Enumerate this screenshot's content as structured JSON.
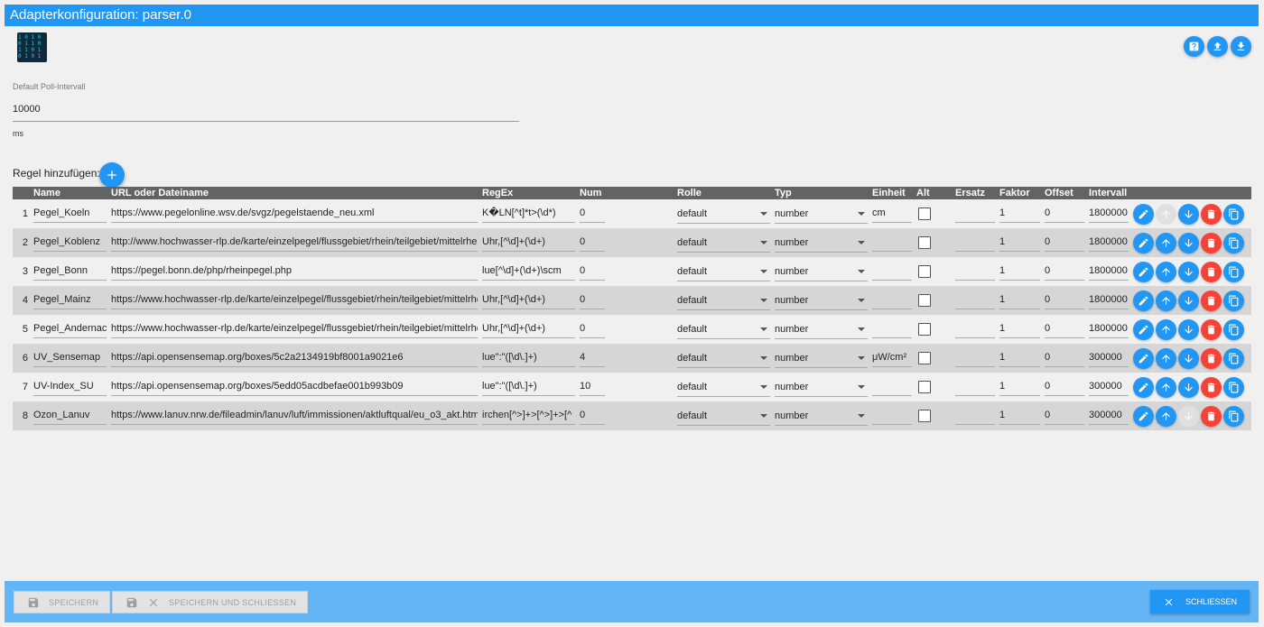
{
  "window": {
    "title": "Adapterkonfiguration: parser.0"
  },
  "logo": {
    "glyph_rows": [
      "1 0 1 0",
      "0 1 1 0",
      "1 1 0 1",
      "0 1 0 1"
    ]
  },
  "poll": {
    "label": "Default Poll-Intervall",
    "value": "10000",
    "unit": "ms"
  },
  "add_rule": {
    "label": "Regel hinzufügen:"
  },
  "table": {
    "headers": [
      "",
      "Name",
      "URL oder Dateiname",
      "RegEx",
      "Num",
      "Rolle",
      "Typ",
      "Einheit",
      "Alt",
      "Ersatz",
      "Faktor",
      "Offset",
      "Intervall",
      ""
    ],
    "rows": [
      {
        "index": "1",
        "name": "Pegel_Koeln",
        "url": "https://www.pegelonline.wsv.de/svgz/pegelstaende_neu.xml",
        "regex": "K�LN[^t]*t>(\\d*)",
        "num": "0",
        "role": "default",
        "type": "number",
        "unit": "cm",
        "subst": "",
        "factor": "1",
        "offset": "0",
        "interval": "1800000",
        "up_enabled": false,
        "down_enabled": true
      },
      {
        "index": "2",
        "name": "Pegel_Koblenz",
        "url": "http://www.hochwasser-rlp.de/karte/einzelpegel/flussgebiet/rhein/teilgebiet/mittelrhein",
        "regex": "Uhr,[^\\d]+(\\d+)",
        "num": "0",
        "role": "default",
        "type": "number",
        "unit": "",
        "subst": "",
        "factor": "1",
        "offset": "0",
        "interval": "1800000",
        "up_enabled": true,
        "down_enabled": true
      },
      {
        "index": "3",
        "name": "Pegel_Bonn",
        "url": "https://pegel.bonn.de/php/rheinpegel.php",
        "regex": "lue[^\\d]+(\\d+)\\scm",
        "num": "0",
        "role": "default",
        "type": "number",
        "unit": "",
        "subst": "",
        "factor": "1",
        "offset": "0",
        "interval": "1800000",
        "up_enabled": true,
        "down_enabled": true
      },
      {
        "index": "4",
        "name": "Pegel_Mainz",
        "url": "https://www.hochwasser-rlp.de/karte/einzelpegel/flussgebiet/rhein/teilgebiet/mittelrhein",
        "regex": "Uhr,[^\\d]+(\\d+)",
        "num": "0",
        "role": "default",
        "type": "number",
        "unit": "",
        "subst": "",
        "factor": "1",
        "offset": "0",
        "interval": "1800000",
        "up_enabled": true,
        "down_enabled": true
      },
      {
        "index": "5",
        "name": "Pegel_Andernach",
        "url": "https://www.hochwasser-rlp.de/karte/einzelpegel/flussgebiet/rhein/teilgebiet/mittelrhein",
        "regex": "Uhr,[^\\d]+(\\d+)",
        "num": "0",
        "role": "default",
        "type": "number",
        "unit": "",
        "subst": "",
        "factor": "1",
        "offset": "0",
        "interval": "1800000",
        "up_enabled": true,
        "down_enabled": true
      },
      {
        "index": "6",
        "name": "UV_Sensemap",
        "url": "https://api.opensensemap.org/boxes/5c2a2134919bf8001a9021e6",
        "regex": "lue\":\"([\\d\\.]+)",
        "num": "4",
        "role": "default",
        "type": "number",
        "unit": "μW/cm²",
        "subst": "",
        "factor": "1",
        "offset": "0",
        "interval": "300000",
        "up_enabled": true,
        "down_enabled": true
      },
      {
        "index": "7",
        "name": "UV-Index_SU",
        "url": "https://api.opensensemap.org/boxes/5edd05acdbefae001b993b09",
        "regex": "lue\":\"([\\d\\.]+)",
        "num": "10",
        "role": "default",
        "type": "number",
        "unit": "",
        "subst": "",
        "factor": "1",
        "offset": "0",
        "interval": "300000",
        "up_enabled": true,
        "down_enabled": true
      },
      {
        "index": "8",
        "name": "Ozon_Lanuv",
        "url": "https://www.lanuv.nrw.de/fileadmin/lanuv/luft/immissionen/aktluftqual/eu_o3_akt.htm",
        "regex": "irchen[^>]+>[^>]+>[^",
        "num": "0",
        "role": "default",
        "type": "number",
        "unit": "",
        "subst": "",
        "factor": "1",
        "offset": "0",
        "interval": "300000",
        "up_enabled": true,
        "down_enabled": false
      }
    ]
  },
  "footer": {
    "save_label": "SPEICHERN",
    "save_close_label": "SPEICHERN UND SCHLIESSEN",
    "close_label": "SCHLIESSEN"
  },
  "colors": {
    "accent": "#2196f3",
    "delete": "#f44336",
    "footer": "#64b5f6",
    "header": "#636363"
  },
  "icons": [
    "help-icon",
    "upload-icon",
    "download-icon",
    "plus-icon",
    "edit-icon",
    "arrow-up-icon",
    "arrow-down-icon",
    "delete-icon",
    "copy-icon",
    "save-icon",
    "close-icon"
  ]
}
